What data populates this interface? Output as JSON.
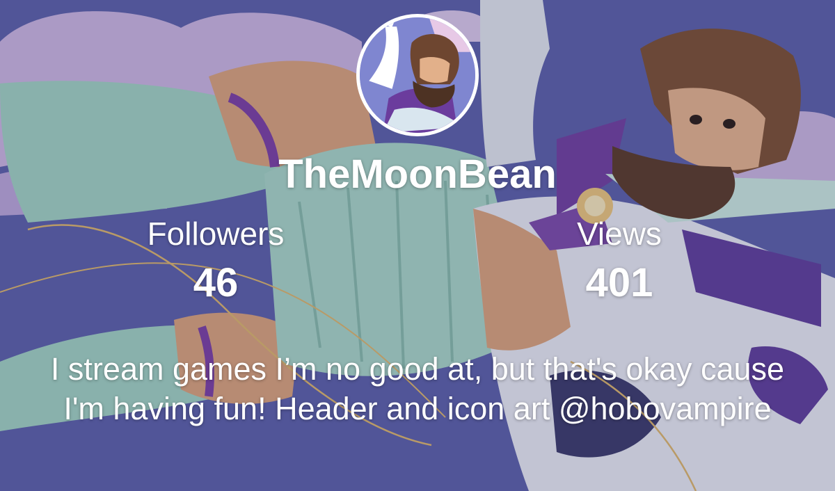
{
  "profile": {
    "username": "TheMoonBean",
    "avatar_icon": "profile-avatar-image",
    "bio": "I stream games I’m no good at, but that's okay cause I'm having fun! Header and icon art @hobovampire"
  },
  "stats": {
    "followers_label": "Followers",
    "followers_value": "46",
    "views_label": "Views",
    "views_value": "401"
  },
  "colors": {
    "sky": "#5b5fa6",
    "cloud": "#c9b3dd",
    "text": "#ffffff"
  }
}
